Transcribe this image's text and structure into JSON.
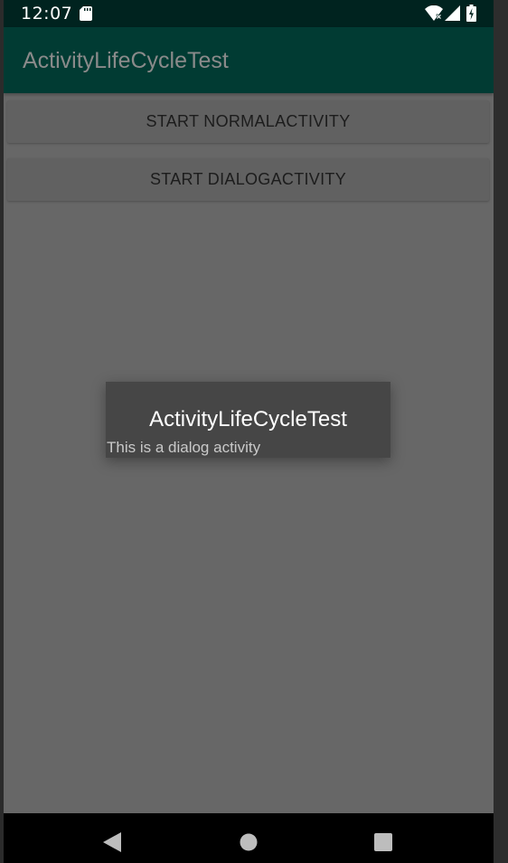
{
  "status_bar": {
    "time": "12:07",
    "icons": [
      "sd-card-icon",
      "wifi-icon",
      "signal-icon",
      "battery-charging-icon"
    ]
  },
  "app_bar": {
    "title": "ActivityLifeCycleTest"
  },
  "buttons": {
    "start_normal": "START NORMALACTIVITY",
    "start_dialog": "START DIALOGACTIVITY"
  },
  "dialog": {
    "title": "ActivityLifeCycleTest",
    "message": "This is a dialog activity"
  },
  "nav_bar": {
    "icons": [
      "back-icon",
      "home-icon",
      "recents-icon"
    ]
  },
  "colors": {
    "status_bar": "#00231f",
    "app_bar": "#013b33",
    "scrim_background": "#676767",
    "dialog_background": "#464646"
  }
}
